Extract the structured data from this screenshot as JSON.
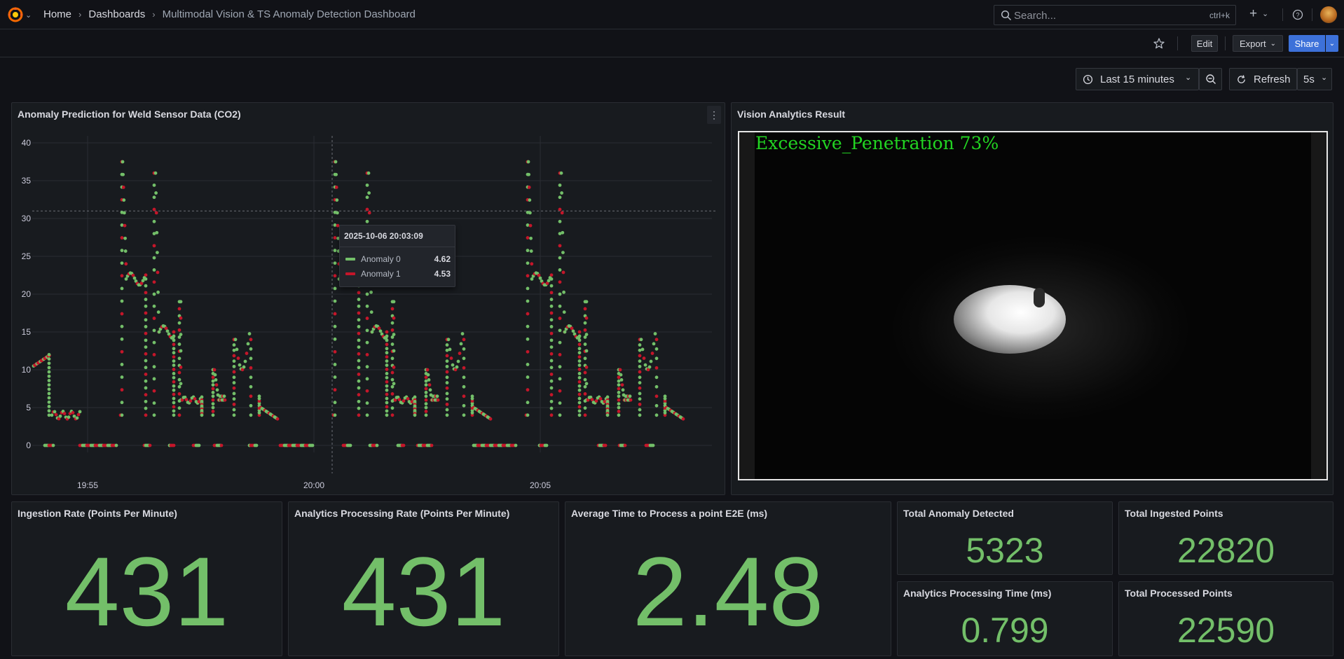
{
  "header": {
    "breadcrumb": [
      "Home",
      "Dashboards",
      "Multimodal Vision & TS Anomaly Detection Dashboard"
    ],
    "search_placeholder": "Search...",
    "search_shortcut": "ctrl+k"
  },
  "toolbar": {
    "edit_label": "Edit",
    "export_label": "Export",
    "share_label": "Share",
    "time_range": "Last 15 minutes",
    "refresh_label": "Refresh",
    "refresh_interval": "5s"
  },
  "panels": {
    "anomaly_chart_title": "Anomaly Prediction for Weld Sensor Data (CO2)",
    "vision_title": "Vision Analytics Result",
    "vision_label": "Excessive_Penetration 73%",
    "ingestion_rate_title": "Ingestion Rate (Points Per Minute)",
    "ingestion_rate_value": "431",
    "analytics_rate_title": "Analytics Processing Rate (Points Per Minute)",
    "analytics_rate_value": "431",
    "avg_time_title": "Average Time to Process a point E2E (ms)",
    "avg_time_value": "2.48",
    "total_anomaly_title": "Total Anomaly Detected",
    "total_anomaly_value": "5323",
    "total_ingested_title": "Total Ingested Points",
    "total_ingested_value": "22820",
    "analytics_time_title": "Analytics Processing Time (ms)",
    "analytics_time_value": "0.799",
    "total_processed_title": "Total Processed Points",
    "total_processed_value": "22590"
  },
  "tooltip": {
    "time": "2025-10-06 20:03:09",
    "rows": [
      {
        "name": "Anomaly 0",
        "value": "4.62"
      },
      {
        "name": "Anomaly 1",
        "value": "4.53"
      }
    ]
  },
  "colors": {
    "anomaly_0": "#73bf69",
    "anomaly_1": "#c4162a",
    "stat_value": "#73bf69",
    "share_button": "#3d71d9"
  },
  "chart_data": {
    "type": "line",
    "title": "Anomaly Prediction for Weld Sensor Data (CO2)",
    "xlabel": "",
    "ylabel": "",
    "ylim": [
      0,
      40
    ],
    "y_ticks": [
      "0",
      "5",
      "10",
      "15",
      "20",
      "25",
      "30",
      "35",
      "40"
    ],
    "x_ticks": [
      "19:55",
      "20:00",
      "20:05"
    ],
    "grid": true,
    "series": [
      {
        "name": "Anomaly 0"
      },
      {
        "name": "Anomaly 1"
      }
    ]
  }
}
